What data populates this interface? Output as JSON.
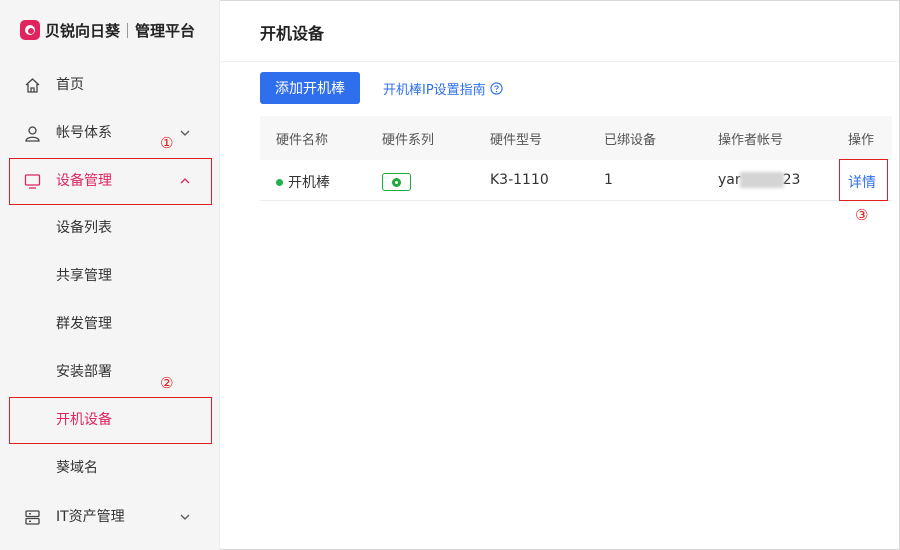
{
  "brand": {
    "name": "贝锐向日葵",
    "subtitle": "管理平台"
  },
  "sidebar": {
    "items": [
      {
        "label": "首页",
        "icon": "home-icon"
      },
      {
        "label": "帐号体系",
        "icon": "user-icon"
      },
      {
        "label": "设备管理",
        "icon": "monitor-icon",
        "expanded": true
      },
      {
        "label": "IT资产管理",
        "icon": "server-icon"
      }
    ],
    "device_sub": [
      {
        "label": "设备列表"
      },
      {
        "label": "共享管理"
      },
      {
        "label": "群发管理"
      },
      {
        "label": "安装部署"
      },
      {
        "label": "开机设备",
        "selected": true
      },
      {
        "label": "葵域名"
      }
    ]
  },
  "annotations": {
    "a1": "①",
    "a2": "②",
    "a3": "③"
  },
  "page": {
    "title": "开机设备",
    "add_button": "添加开机棒",
    "guide_link": "开机棒IP设置指南"
  },
  "table": {
    "headers": [
      "硬件名称",
      "硬件系列",
      "硬件型号",
      "已绑设备",
      "操作者帐号",
      "操作"
    ],
    "rows": [
      {
        "name": "开机棒",
        "status": "online",
        "model": "K3-1110",
        "bound": "1",
        "operator_prefix": "yar",
        "operator_suffix": "23",
        "action": "详情"
      }
    ]
  },
  "colors": {
    "accent": "#e0245e",
    "primary": "#2f6fed",
    "annotation": "#e02020",
    "online": "#22b14c"
  }
}
